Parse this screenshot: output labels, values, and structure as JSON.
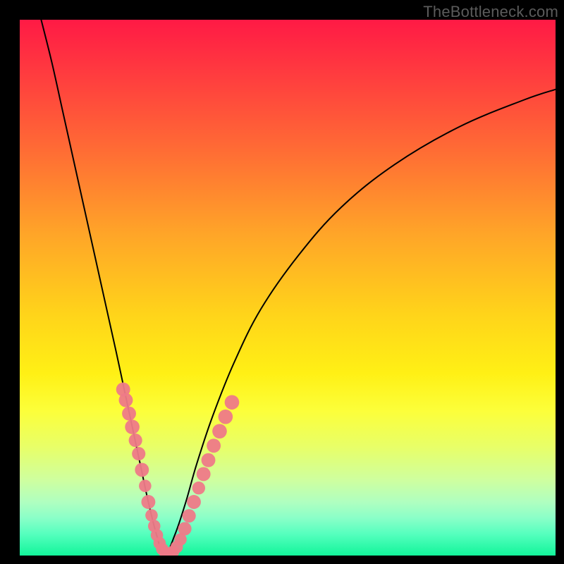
{
  "watermark": "TheBottleneck.com",
  "chart_data": {
    "type": "line",
    "title": "",
    "xlabel": "",
    "ylabel": "",
    "xlim": [
      0,
      100
    ],
    "ylim": [
      0,
      100
    ],
    "gradient_stops": [
      {
        "pct": 0,
        "color": "#ff1a45"
      },
      {
        "pct": 10,
        "color": "#ff3b3f"
      },
      {
        "pct": 25,
        "color": "#ff6e34"
      },
      {
        "pct": 40,
        "color": "#ffa528"
      },
      {
        "pct": 55,
        "color": "#ffd41a"
      },
      {
        "pct": 66,
        "color": "#fff015"
      },
      {
        "pct": 73,
        "color": "#fcff3a"
      },
      {
        "pct": 80,
        "color": "#e7ff6a"
      },
      {
        "pct": 86,
        "color": "#ceffa0"
      },
      {
        "pct": 90,
        "color": "#b0ffc0"
      },
      {
        "pct": 93,
        "color": "#8affc8"
      },
      {
        "pct": 96,
        "color": "#55ffbe"
      },
      {
        "pct": 100,
        "color": "#12f59a"
      }
    ],
    "series": [
      {
        "name": "left-arm",
        "x": [
          4,
          6,
          8,
          10,
          12,
          14,
          16,
          18,
          19.5,
          21,
          22.5,
          24,
          25.5,
          27
        ],
        "y": [
          100,
          92,
          83,
          74,
          65,
          56,
          47,
          38,
          31,
          24,
          17,
          10,
          4,
          0
        ]
      },
      {
        "name": "right-arm",
        "x": [
          27,
          29,
          31,
          33,
          36,
          40,
          45,
          52,
          60,
          70,
          82,
          94,
          100
        ],
        "y": [
          0,
          4,
          10,
          17,
          26,
          36,
          46,
          56,
          65,
          73,
          80,
          85,
          87
        ]
      }
    ],
    "markers": {
      "name": "data-dots",
      "color": "#ee7a88",
      "points": [
        {
          "x": 19.3,
          "y": 31,
          "r": 1.3
        },
        {
          "x": 19.8,
          "y": 29,
          "r": 1.3
        },
        {
          "x": 20.4,
          "y": 26.5,
          "r": 1.3
        },
        {
          "x": 21.0,
          "y": 24,
          "r": 1.4
        },
        {
          "x": 21.6,
          "y": 21.5,
          "r": 1.2
        },
        {
          "x": 22.2,
          "y": 19,
          "r": 1.2
        },
        {
          "x": 22.8,
          "y": 16,
          "r": 1.3
        },
        {
          "x": 23.4,
          "y": 13,
          "r": 1.0
        },
        {
          "x": 24.0,
          "y": 10,
          "r": 1.3
        },
        {
          "x": 24.6,
          "y": 7.5,
          "r": 1.0
        },
        {
          "x": 25.1,
          "y": 5.5,
          "r": 1.0
        },
        {
          "x": 25.6,
          "y": 3.8,
          "r": 1.0
        },
        {
          "x": 26.1,
          "y": 2.3,
          "r": 1.0
        },
        {
          "x": 26.6,
          "y": 1.2,
          "r": 1.0
        },
        {
          "x": 27.2,
          "y": 0.5,
          "r": 1.0
        },
        {
          "x": 27.9,
          "y": 0.3,
          "r": 1.0
        },
        {
          "x": 28.6,
          "y": 0.7,
          "r": 1.0
        },
        {
          "x": 29.3,
          "y": 1.6,
          "r": 1.0
        },
        {
          "x": 30.0,
          "y": 3.0,
          "r": 1.0
        },
        {
          "x": 30.8,
          "y": 5.0,
          "r": 1.2
        },
        {
          "x": 31.6,
          "y": 7.4,
          "r": 1.2
        },
        {
          "x": 32.5,
          "y": 10.0,
          "r": 1.3
        },
        {
          "x": 33.4,
          "y": 12.6,
          "r": 1.1
        },
        {
          "x": 34.3,
          "y": 15.2,
          "r": 1.3
        },
        {
          "x": 35.2,
          "y": 17.8,
          "r": 1.3
        },
        {
          "x": 36.2,
          "y": 20.5,
          "r": 1.3
        },
        {
          "x": 37.3,
          "y": 23.2,
          "r": 1.4
        },
        {
          "x": 38.4,
          "y": 25.9,
          "r": 1.4
        },
        {
          "x": 39.6,
          "y": 28.6,
          "r": 1.4
        }
      ]
    }
  }
}
